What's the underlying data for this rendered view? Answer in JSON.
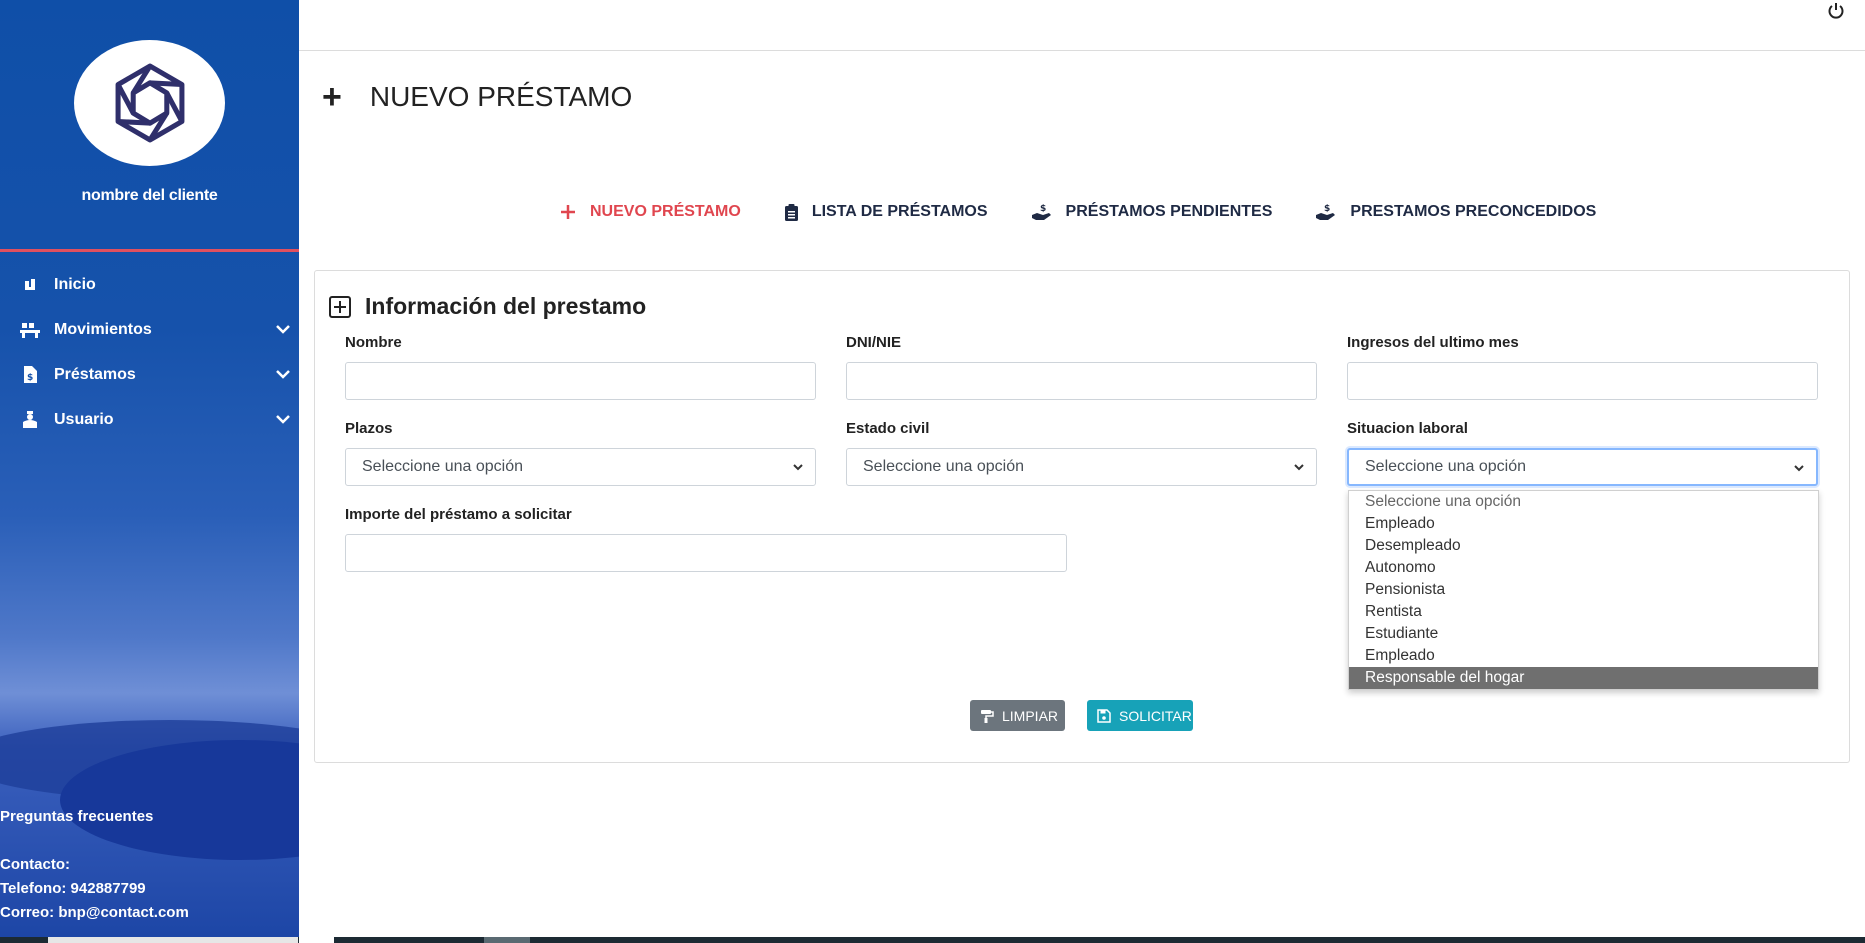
{
  "sidebar": {
    "client_name": "nombre del cliente",
    "menu": [
      {
        "label": "Inicio",
        "icon": "home-icon",
        "has_submenu": false
      },
      {
        "label": "Movimientos",
        "icon": "movements-icon",
        "has_submenu": true
      },
      {
        "label": "Préstamos",
        "icon": "loan-document-icon",
        "has_submenu": true
      },
      {
        "label": "Usuario",
        "icon": "user-icon",
        "has_submenu": true
      }
    ],
    "faq": "Preguntas frecuentes",
    "contact_title": "Contacto:",
    "phone": "Telefono: 942887799",
    "email": "Correo: bnp@contact.com"
  },
  "header": {
    "title": "NUEVO PRÉSTAMO",
    "power_icon": "power-icon"
  },
  "tabs": [
    {
      "label": "NUEVO PRÉSTAMO",
      "icon": "plus-icon",
      "active": true
    },
    {
      "label": "LISTA DE PRÉSTAMOS",
      "icon": "clipboard-icon",
      "active": false
    },
    {
      "label": "PRÉSTAMOS PENDIENTES",
      "icon": "hand-money-icon",
      "active": false
    },
    {
      "label": "PRESTAMOS PRECONCEDIDOS",
      "icon": "hand-money-icon",
      "active": false
    }
  ],
  "form": {
    "title": "Información del prestamo",
    "fields": {
      "nombre": {
        "label": "Nombre",
        "value": ""
      },
      "dni": {
        "label": "DNI/NIE",
        "value": ""
      },
      "ingresos": {
        "label": "Ingresos del ultimo mes",
        "value": ""
      },
      "plazos": {
        "label": "Plazos",
        "value": "Seleccione una opción"
      },
      "estado_civil": {
        "label": "Estado civil",
        "value": "Seleccione una opción"
      },
      "situacion": {
        "label": "Situacion laboral",
        "value": "Seleccione una opción"
      },
      "importe": {
        "label": "Importe del préstamo a solicitar",
        "value": ""
      }
    },
    "situacion_options": [
      "Seleccione una opción",
      "Empleado",
      "Desempleado",
      "Autonomo",
      "Pensionista",
      "Rentista",
      "Estudiante",
      "Empleado",
      "Responsable del hogar"
    ],
    "highlighted_option": "Responsable del hogar",
    "buttons": {
      "clear": "LIMPIAR",
      "submit": "SOLICITAR"
    }
  },
  "colors": {
    "sidebar": "#1652ab",
    "active_tab": "#e0464f",
    "clear_button": "#6c757d",
    "submit_button": "#17a2b8"
  }
}
